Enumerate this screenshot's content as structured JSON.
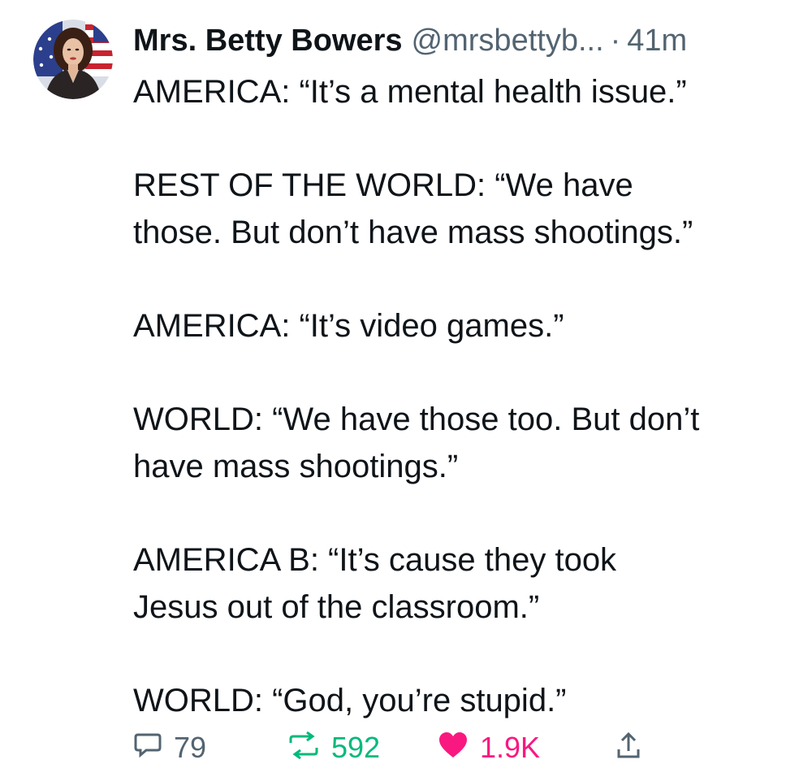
{
  "tweet": {
    "author": {
      "display_name": "Mrs. Betty Bowers",
      "handle": "@mrsbettyb...",
      "separator": "·",
      "time": "41m",
      "avatar_icon": "avatar-photo"
    },
    "paragraphs": [
      {
        "lines": [
          "AMERICA: “It’s a mental health issue.”"
        ]
      },
      {
        "lines": [
          "REST OF THE WORLD: “We have",
          "those. But don’t have mass shootings.”"
        ]
      },
      {
        "lines": [
          "AMERICA: “It’s video games.”"
        ]
      },
      {
        "lines": [
          "WORLD: “We have those too. But don’t",
          "have mass shootings.”"
        ]
      },
      {
        "lines": [
          "AMERICA B: “It’s cause they took",
          "Jesus out of the classroom.”"
        ]
      },
      {
        "lines": [
          "WORLD: “God, you’re stupid.”"
        ]
      }
    ],
    "actions": {
      "reply": {
        "icon": "reply-icon",
        "count": "79"
      },
      "retweet": {
        "icon": "retweet-icon",
        "count": "592"
      },
      "like": {
        "icon": "heart-icon",
        "count": "1.9K"
      },
      "share": {
        "icon": "share-icon"
      }
    },
    "colors": {
      "text": "#0f1419",
      "secondary": "#536471",
      "retweet": "#00ba7c",
      "like": "#f91880"
    }
  }
}
